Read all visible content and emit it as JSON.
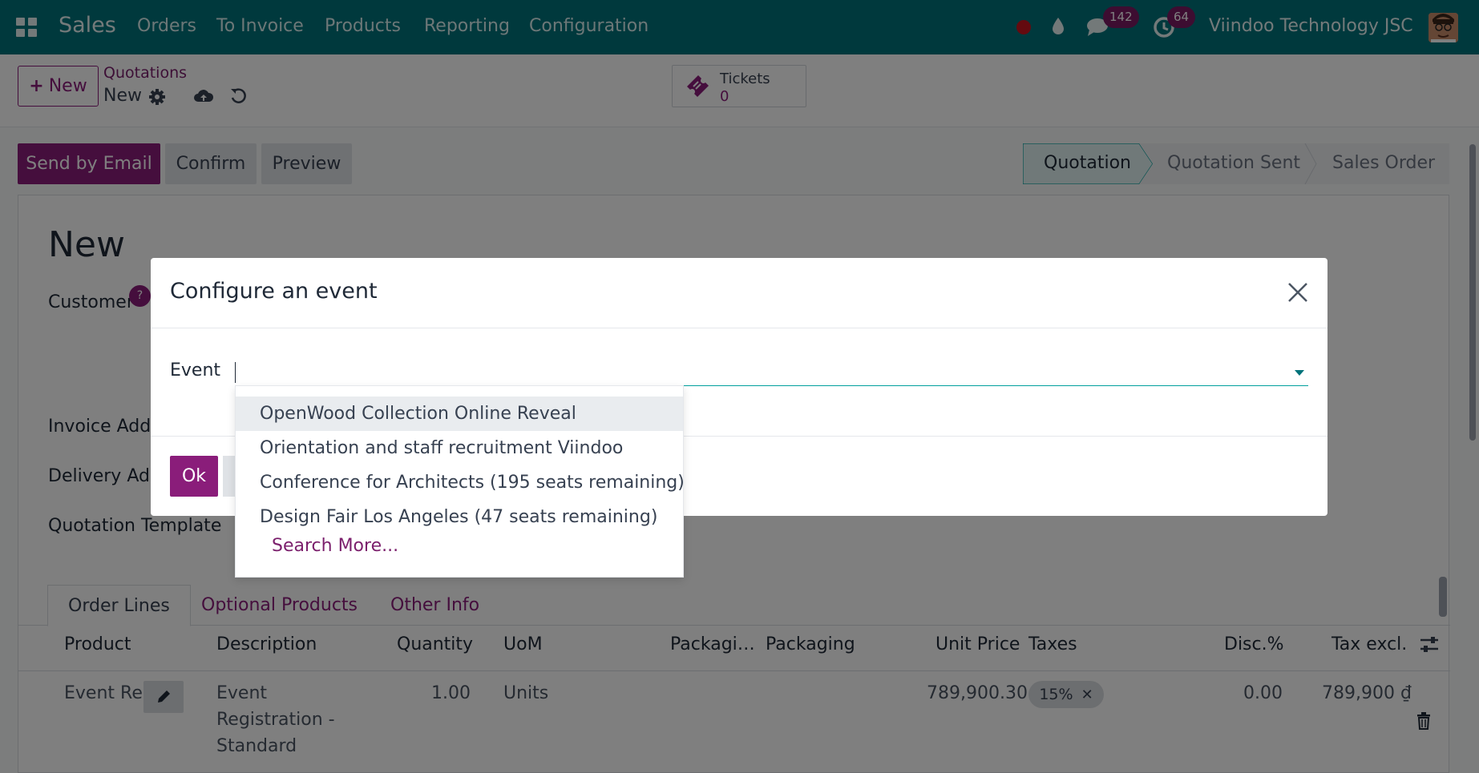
{
  "navbar": {
    "brand": "Sales",
    "menu": [
      "Orders",
      "To Invoice",
      "Products",
      "Reporting",
      "Configuration"
    ],
    "messages_count": "142",
    "activities_count": "64",
    "company": "Viindoo Technology JSC"
  },
  "control_panel": {
    "new_label": "New",
    "breadcrumb_parent": "Quotations",
    "breadcrumb_current": "New",
    "tickets_label": "Tickets",
    "tickets_count": "0"
  },
  "header_buttons": {
    "send_email": "Send by Email",
    "confirm": "Confirm",
    "preview": "Preview"
  },
  "pipeline": {
    "stages": [
      "Quotation",
      "Quotation Sent",
      "Sales Order"
    ],
    "active": "Quotation"
  },
  "form": {
    "title": "New",
    "customer_label": "Customer",
    "help_mark": "?",
    "invoice_address_label": "Invoice Addr",
    "delivery_address_label": "Delivery Add",
    "quotation_template_label": "Quotation Template"
  },
  "tabs": [
    "Order Lines",
    "Optional Products",
    "Other Info"
  ],
  "order_lines": {
    "columns": [
      "Product",
      "Description",
      "Quantity",
      "UoM",
      "Packagi…",
      "Packaging",
      "Unit Price",
      "Taxes",
      "Disc.%",
      "Tax excl."
    ],
    "row": {
      "product": "Event Reg",
      "description_1": "Event",
      "description_2": "Registration -",
      "description_3": "Standard",
      "quantity": "1.00",
      "uom": "Units",
      "unit_price": "789,900.30",
      "tax": "15%",
      "discount": "0.00",
      "subtotal": "789,900 ₫"
    }
  },
  "dialog": {
    "title": "Configure an event",
    "event_label": "Event",
    "event_value": "",
    "ok_label": "Ok",
    "options": [
      "OpenWood Collection Online Reveal",
      "Orientation and staff recruitment Viindoo",
      "Conference for Architects (195 seats remaining)",
      "Design Fair Los Angeles (47 seats remaining)"
    ],
    "search_more": "Search More..."
  },
  "colors": {
    "navbar": "#00727a",
    "primary": "#8a1d7a",
    "accent": "#00a09d"
  }
}
